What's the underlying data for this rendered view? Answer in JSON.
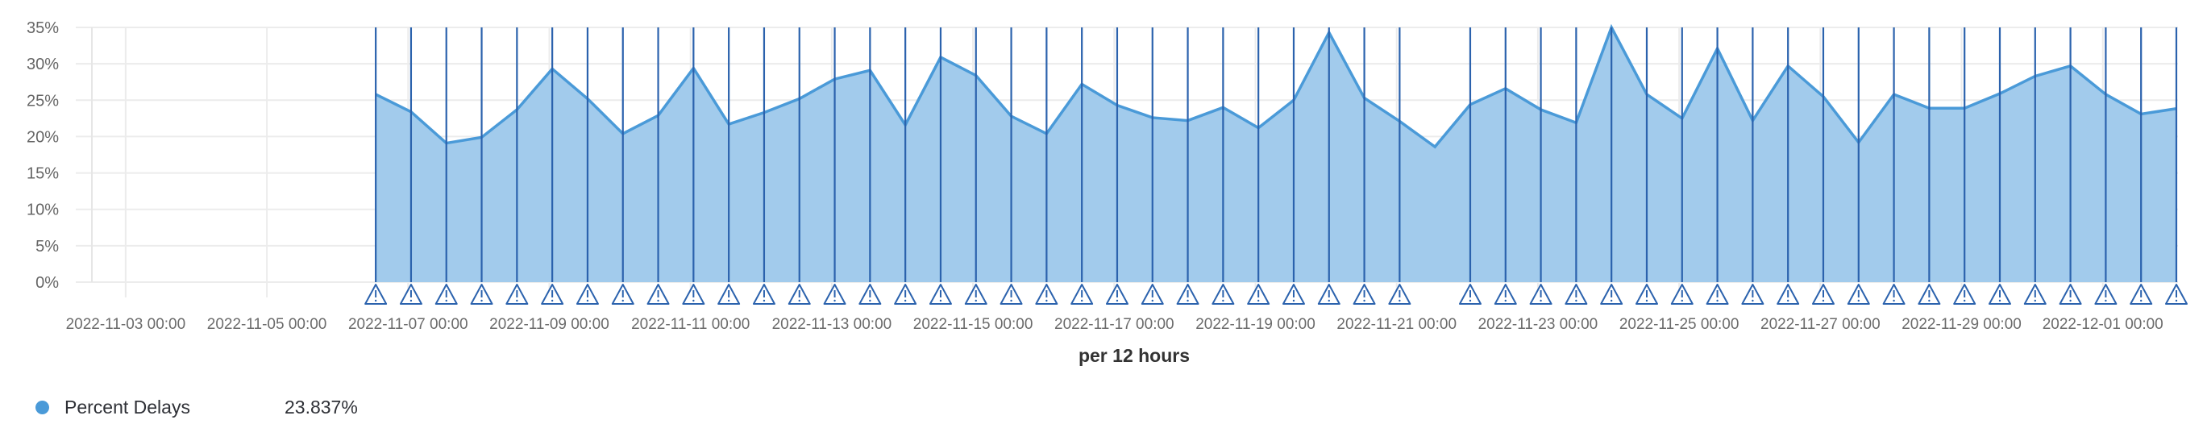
{
  "chart_data": {
    "type": "area",
    "title": "",
    "xlabel": "per 12 hours",
    "ylabel": "",
    "y_unit": "%",
    "ylim": [
      0,
      35
    ],
    "y_ticks": [
      "0%",
      "5%",
      "10%",
      "15%",
      "20%",
      "25%",
      "30%",
      "35%"
    ],
    "y_tick_values": [
      0,
      5,
      10,
      15,
      20,
      25,
      30,
      35
    ],
    "x_range": [
      "2022-11-02 06:30",
      "2022-12-02 01:00"
    ],
    "x_ticks": [
      "2022-11-03 00:00",
      "2022-11-05 00:00",
      "2022-11-07 00:00",
      "2022-11-09 00:00",
      "2022-11-11 00:00",
      "2022-11-13 00:00",
      "2022-11-15 00:00",
      "2022-11-17 00:00",
      "2022-11-19 00:00",
      "2022-11-21 00:00",
      "2022-11-23 00:00",
      "2022-11-25 00:00",
      "2022-11-27 00:00",
      "2022-11-29 00:00",
      "2022-12-01 00:00"
    ],
    "grid": true,
    "interval_hours": 12,
    "x_start": "2022-11-06 13:00",
    "series": [
      {
        "name": "Percent Delays",
        "color": "#4a9ad8",
        "fill": "#a2cbec",
        "values": [
          25.8,
          23.4,
          19.1,
          19.9,
          23.7,
          29.3,
          25.2,
          20.4,
          22.9,
          29.4,
          21.7,
          23.3,
          25.2,
          27.9,
          29.1,
          21.6,
          30.9,
          28.4,
          22.8,
          20.4,
          27.2,
          24.3,
          22.6,
          22.2,
          24.0,
          21.2,
          25.0,
          34.3,
          25.3,
          22.1,
          18.6,
          24.4,
          26.6,
          23.7,
          21.9,
          35.0,
          25.8,
          22.5,
          32.1,
          22.2,
          29.7,
          25.5,
          19.2,
          25.8,
          23.9,
          23.9,
          25.9,
          28.3,
          29.7,
          25.8,
          23.1,
          23.837
        ]
      }
    ],
    "annotations": {
      "type": "alert-marker",
      "icon": "warning-triangle-icon",
      "color": "#2b62ad",
      "flags": [
        1,
        1,
        1,
        1,
        1,
        1,
        1,
        1,
        1,
        1,
        1,
        1,
        1,
        1,
        1,
        1,
        1,
        1,
        1,
        1,
        1,
        1,
        1,
        1,
        1,
        1,
        1,
        1,
        1,
        1,
        0,
        1,
        1,
        1,
        1,
        1,
        1,
        1,
        1,
        1,
        1,
        1,
        1,
        1,
        1,
        1,
        1,
        1,
        1,
        1,
        1,
        1
      ]
    },
    "legend_position": "bottom-left"
  },
  "legend": {
    "items": [
      {
        "label": "Percent Delays",
        "value": "23.837%",
        "color": "#4a9ad8"
      }
    ]
  }
}
